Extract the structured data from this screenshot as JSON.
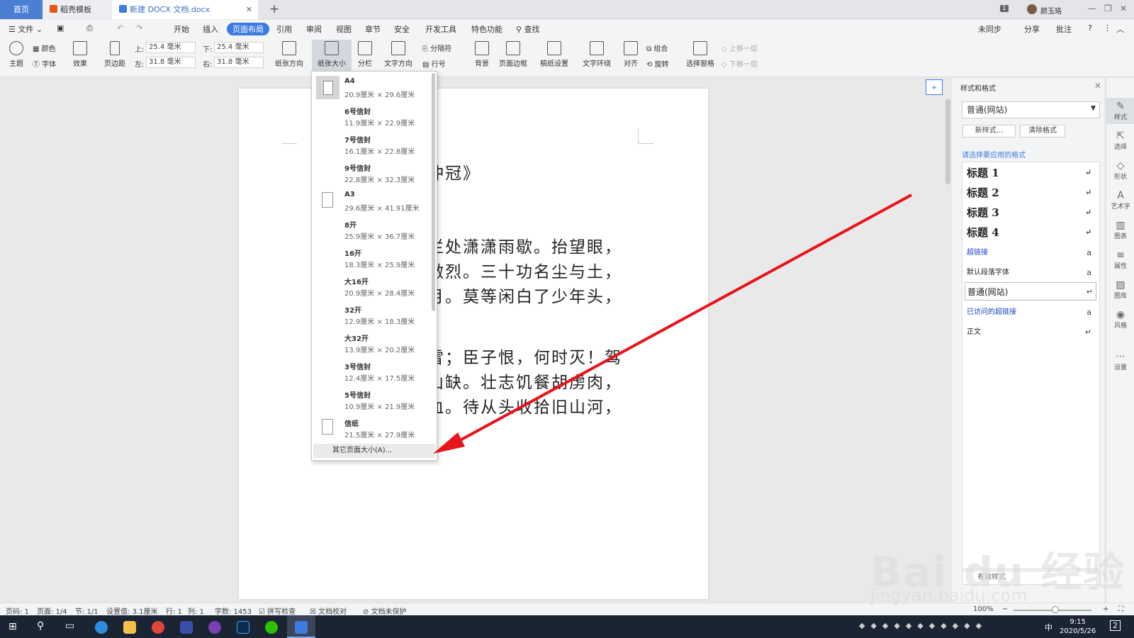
{
  "titlebar": {
    "tab_home": "首页",
    "tab_template": "稻壳模板",
    "tab_doc": "新建 DOCX 文档.docx",
    "badge": "1",
    "user": "颜玉珞"
  },
  "menubar": {
    "file": "文件",
    "items": [
      "开始",
      "插入",
      "页面布局",
      "引用",
      "审阅",
      "视图",
      "章节",
      "安全",
      "开发工具",
      "特色功能"
    ],
    "search": "查找",
    "right": [
      "未同步",
      "分享",
      "批注"
    ]
  },
  "ribbon": {
    "theme": "主题",
    "color": "颜色",
    "font": "字体",
    "effect": "效果",
    "margins": "页边距",
    "top_label": "上:",
    "top_value": "25.4 毫米",
    "bottom_label": "下:",
    "bottom_value": "25.4 毫米",
    "left_label": "左:",
    "left_value": "31.8 毫米",
    "right_label": "右:",
    "right_value": "31.8 毫米",
    "orientation": "纸张方向",
    "paper_size": "纸张大小",
    "columns": "分栏",
    "text_direction": "文字方向",
    "separator": "分隔符",
    "line_number": "行号",
    "background": "背景",
    "page_border": "页面边框",
    "draft": "稿纸设置",
    "wrap": "文字环绕",
    "align": "对齐",
    "group": "组合",
    "rotate": "旋转",
    "selection_pane": "选择窗格",
    "bring_forward": "上移一层",
    "send_backward": "下移一层"
  },
  "paper_sizes": [
    {
      "name": "A4",
      "dims": "20.9厘米 × 29.6厘米"
    },
    {
      "name": "6号信封",
      "dims": "11.9厘米 × 22.9厘米"
    },
    {
      "name": "7号信封",
      "dims": "16.1厘米 × 22.8厘米"
    },
    {
      "name": "9号信封",
      "dims": "22.8厘米 × 32.3厘米"
    },
    {
      "name": "A3",
      "dims": "29.6厘米 × 41.91厘米"
    },
    {
      "name": "8开",
      "dims": "25.9厘米 × 36.7厘米"
    },
    {
      "name": "16开",
      "dims": "18.3厘米 × 25.9厘米"
    },
    {
      "name": "大16开",
      "dims": "20.9厘米 × 28.4厘米"
    },
    {
      "name": "32开",
      "dims": "12.9厘米 × 18.3厘米"
    },
    {
      "name": "大32开",
      "dims": "13.9厘米 × 20.2厘米"
    },
    {
      "name": "3号信封",
      "dims": "12.4厘米 × 17.5厘米"
    },
    {
      "name": "5号信封",
      "dims": "10.9厘米 × 21.9厘米"
    },
    {
      "name": "信纸",
      "dims": "21.5厘米 × 27.9厘米"
    }
  ],
  "more_sizes": "其它页面大小(A)...",
  "document": {
    "lines": [
      "冲冠》",
      "栏处潇潇雨歇。抬望眼，",
      "激烈。三十功名尘与土，",
      "月。莫等闲白了少年头，",
      "雪；臣子恨，何时灭！驾",
      "山缺。壮志饥餐胡虏肉，",
      "血。待从头收拾旧山河，"
    ]
  },
  "style_panel": {
    "title": "样式和格式",
    "current": "普通(网站)",
    "new_style": "新样式...",
    "clear_format": "清除格式",
    "prompt": "请选择要应用的格式",
    "items": [
      {
        "label": "标题 1",
        "mark": "↵"
      },
      {
        "label": "标题 2",
        "mark": "↵"
      },
      {
        "label": "标题 3",
        "mark": "↵"
      },
      {
        "label": "标题 4",
        "mark": "↵"
      },
      {
        "label": "超链接",
        "mark": "a"
      },
      {
        "label": "默认段落字体",
        "mark": "a"
      },
      {
        "label": "普通(网站)",
        "mark": "↵"
      },
      {
        "label": "已访问的超链接",
        "mark": "a"
      },
      {
        "label": "正文",
        "mark": "↵"
      }
    ],
    "show": "有效样式"
  },
  "right_toolbar": [
    "样式",
    "选择",
    "形状",
    "艺术字",
    "图表",
    "属性",
    "图库",
    "风格",
    "设置"
  ],
  "statusbar": {
    "page_num": "页码: 1",
    "page": "页面: 1/4",
    "section": "节: 1/1",
    "setting": "设置值: 3.1厘米",
    "row": "行: 1",
    "col": "列: 1",
    "words": "字数: 1453",
    "spell": "拼写检查",
    "proof": "文档校对",
    "protect": "文档未保护",
    "zoom": "100%"
  },
  "taskbar": {
    "time": "9:15",
    "date": "2020/5/26",
    "ime": "中",
    "notif": "2"
  },
  "watermark": {
    "brand": "Bai du 经验",
    "url": "jingyan.baidu.com"
  },
  "colors": {
    "accent": "#3d7be0",
    "arrow": "#e8141a"
  }
}
